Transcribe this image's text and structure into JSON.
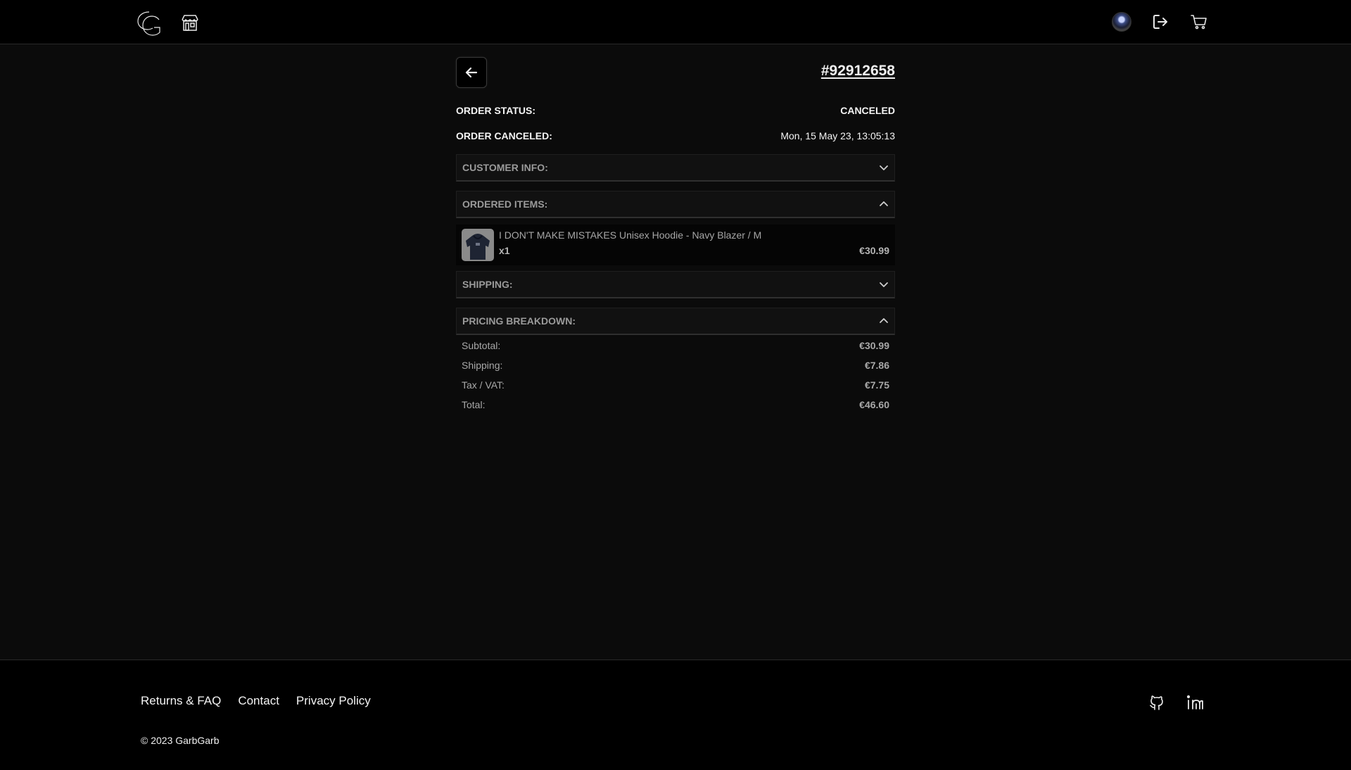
{
  "header": {
    "logo_icon": "garbgarb-logo",
    "store_icon": "store-icon",
    "avatar_icon": "user-avatar",
    "logout_icon": "logout-icon",
    "cart_icon": "cart-icon"
  },
  "order": {
    "id": "#92912658",
    "status_label": "ORDER STATUS:",
    "status_value": "CANCELED",
    "canceled_label": "ORDER CANCELED:",
    "canceled_value": "Mon, 15 May 23, 13:05:13"
  },
  "sections": {
    "customer_info": "CUSTOMER INFO:",
    "ordered_items": "ORDERED ITEMS:",
    "shipping": "SHIPPING:",
    "pricing": "PRICING BREAKDOWN:"
  },
  "items": [
    {
      "name": "I DON'T MAKE MISTAKES Unisex Hoodie - Navy Blazer / M",
      "qty": "x1",
      "price": "€30.99"
    }
  ],
  "pricing": [
    {
      "label": "Subtotal:",
      "value": "€30.99"
    },
    {
      "label": "Shipping:",
      "value": "€7.86"
    },
    {
      "label": "Tax / VAT:",
      "value": "€7.75"
    },
    {
      "label": "Total:",
      "value": "€46.60"
    }
  ],
  "footer": {
    "links": [
      "Returns & FAQ",
      "Contact",
      "Privacy Policy"
    ],
    "copyright": "© 2023 GarbGarb",
    "github_icon": "github-icon",
    "linkedin_icon": "linkedin-icon"
  },
  "colors": {
    "background": "#0b0b0b",
    "header": "#000000",
    "text": "#f2f2f2",
    "muted": "#9a9a9a"
  }
}
